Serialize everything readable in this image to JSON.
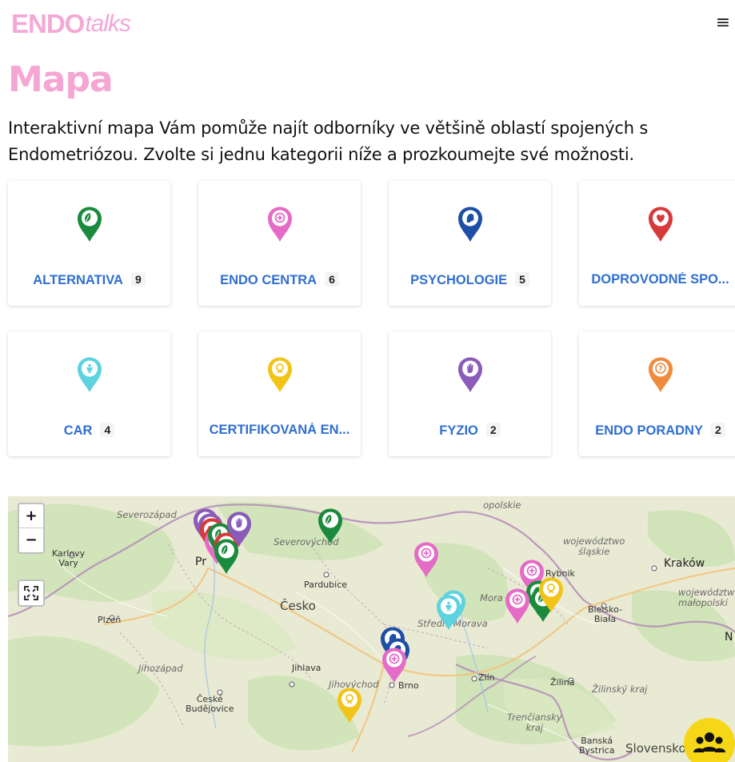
{
  "header": {
    "logo_part1": "ENDO",
    "logo_part2": "talks",
    "menu_icon": "hamburger-menu-icon"
  },
  "page": {
    "title": "Mapa",
    "intro": "Interaktivní mapa Vám pomůže najít odborníky ve většině oblastí spojených s Endometriózou. Zvolte si jednu kategorii níže a prozkoumejte své možnosti."
  },
  "categories": [
    {
      "label": "ALTERNATIVA",
      "count": "9",
      "color": "#1a8a3c",
      "icon": "leaf-icon"
    },
    {
      "label": "ENDO CENTRA",
      "count": "6",
      "color": "#e46cc6",
      "icon": "medical-cross-icon"
    },
    {
      "label": "PSYCHOLOGIE",
      "count": "5",
      "color": "#1d4fa6",
      "icon": "head-icon"
    },
    {
      "label": "DOPROVODNÉ SPO...",
      "count": "",
      "color": "#d63a3a",
      "icon": "heart-icon"
    },
    {
      "label": "CAR",
      "count": "4",
      "color": "#5ed3e0",
      "icon": "person-icon"
    },
    {
      "label": "CERTIFIKOVANÁ EN...",
      "count": "",
      "color": "#f2c418",
      "icon": "certificate-icon"
    },
    {
      "label": "FYZIO",
      "count": "2",
      "color": "#8a5bb8",
      "icon": "hand-icon"
    },
    {
      "label": "ENDO PORADNY",
      "count": "2",
      "color": "#f08a3c",
      "icon": "question-icon"
    }
  ],
  "map": {
    "zoom_in": "+",
    "zoom_out": "−",
    "fullscreen_icon": "fullscreen-icon",
    "labels": {
      "severozapad": "Severozápad",
      "severovychod": "Severovýchod",
      "karlovy_vary": "Karlovy\nVary",
      "praha": "Pr",
      "pardubice": "Pardubice",
      "cesko": "Česko",
      "plzen": "Plzeň",
      "jihozapad": "Jihozápad",
      "jihlava": "Jihlava",
      "jihovychod": "Jihovýchod",
      "brno": "Brno",
      "ceske_budejovice": "České\nBudějovice",
      "zlin": "Zlín",
      "stredni_morava": "Střední Morava",
      "morava": "Mora",
      "opolskie": "opolskie",
      "slaskie": "województwo\nśląskie",
      "rybnik": "Rybnik",
      "krakow": "Kraków",
      "malopolskie": "województw\nmałopolski",
      "bielsko": "Bielsko-\nBiała",
      "zilina": "Žilina",
      "zilinsky": "Žilinský kraj",
      "trencin": "Trenčiansky\nkraj",
      "banska": "Banská\nBystrica",
      "slovensko": "Slovensko",
      "n": "N"
    }
  },
  "community_icon": "community-icon"
}
